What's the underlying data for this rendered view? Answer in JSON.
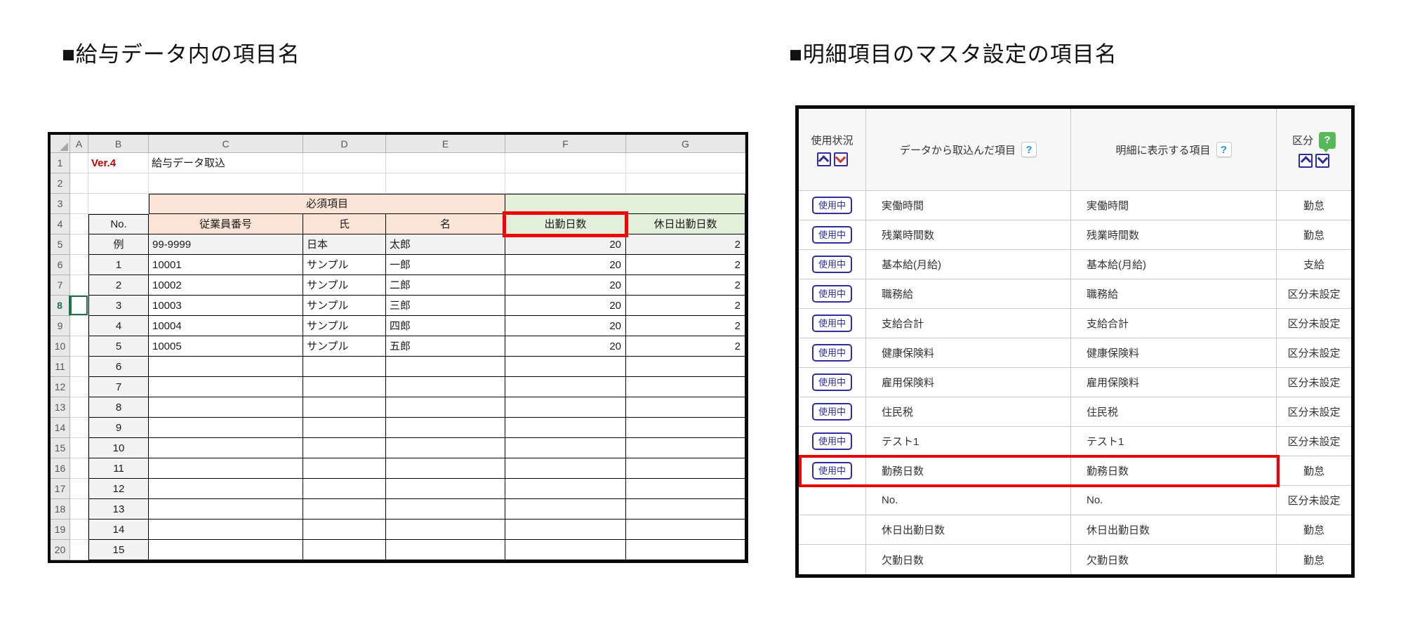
{
  "left_panel": {
    "title": "■給与データ内の項目名",
    "spreadsheet": {
      "column_headers": [
        "A",
        "B",
        "C",
        "D",
        "E",
        "F",
        "G"
      ],
      "rows_total": 20,
      "version_label": "Ver.4",
      "sheet_title": "給与データ取込",
      "required_banner": "必須項目",
      "table_headers": [
        "No.",
        "従業員番号",
        "氏",
        "名",
        "出勤日数",
        "休日出勤日数"
      ],
      "data_rows": [
        [
          "例",
          "99-9999",
          "日本",
          "太郎",
          "20",
          "2"
        ],
        [
          "1",
          "10001",
          "サンプル",
          "一郎",
          "20",
          "2"
        ],
        [
          "2",
          "10002",
          "サンプル",
          "二郎",
          "20",
          "2"
        ],
        [
          "3",
          "10003",
          "サンプル",
          "三郎",
          "20",
          "2"
        ],
        [
          "4",
          "10004",
          "サンプル",
          "四郎",
          "20",
          "2"
        ],
        [
          "5",
          "10005",
          "サンプル",
          "五郎",
          "20",
          "2"
        ],
        [
          "6",
          "",
          "",
          "",
          "",
          ""
        ],
        [
          "7",
          "",
          "",
          "",
          "",
          ""
        ],
        [
          "8",
          "",
          "",
          "",
          "",
          ""
        ],
        [
          "9",
          "",
          "",
          "",
          "",
          ""
        ],
        [
          "10",
          "",
          "",
          "",
          "",
          ""
        ],
        [
          "11",
          "",
          "",
          "",
          "",
          ""
        ],
        [
          "12",
          "",
          "",
          "",
          "",
          ""
        ],
        [
          "13",
          "",
          "",
          "",
          "",
          ""
        ],
        [
          "14",
          "",
          "",
          "",
          "",
          ""
        ],
        [
          "15",
          "",
          "",
          "",
          "",
          ""
        ]
      ],
      "active_row_header": 8,
      "highlighted_header": "出勤日数"
    }
  },
  "right_panel": {
    "title": "■明細項目のマスタ設定の項目名",
    "table": {
      "headers": {
        "usage": "使用状況",
        "imported": "データから取込んだ項目",
        "display": "明細に表示する項目",
        "kubun": "区分"
      },
      "help_label": "?",
      "in_use_label": "使用中",
      "rows": [
        {
          "in_use": true,
          "imported": "実働時間",
          "display": "実働時間",
          "kubun": "勤怠",
          "highlighted": false
        },
        {
          "in_use": true,
          "imported": "残業時間数",
          "display": "残業時間数",
          "kubun": "勤怠",
          "highlighted": false
        },
        {
          "in_use": true,
          "imported": "基本給(月給)",
          "display": "基本給(月給)",
          "kubun": "支給",
          "highlighted": false
        },
        {
          "in_use": true,
          "imported": "職務給",
          "display": "職務給",
          "kubun": "区分未設定",
          "highlighted": false
        },
        {
          "in_use": true,
          "imported": "支給合計",
          "display": "支給合計",
          "kubun": "区分未設定",
          "highlighted": false
        },
        {
          "in_use": true,
          "imported": "健康保険料",
          "display": "健康保険料",
          "kubun": "区分未設定",
          "highlighted": false
        },
        {
          "in_use": true,
          "imported": "雇用保険料",
          "display": "雇用保険料",
          "kubun": "区分未設定",
          "highlighted": false
        },
        {
          "in_use": true,
          "imported": "住民税",
          "display": "住民税",
          "kubun": "区分未設定",
          "highlighted": false
        },
        {
          "in_use": true,
          "imported": "テスト1",
          "display": "テスト1",
          "kubun": "区分未設定",
          "highlighted": false
        },
        {
          "in_use": true,
          "imported": "勤務日数",
          "display": "勤務日数",
          "kubun": "勤怠",
          "highlighted": true
        },
        {
          "in_use": false,
          "imported": "No.",
          "display": "No.",
          "kubun": "区分未設定",
          "highlighted": false
        },
        {
          "in_use": false,
          "imported": "休日出勤日数",
          "display": "休日出勤日数",
          "kubun": "勤怠",
          "highlighted": false
        },
        {
          "in_use": false,
          "imported": "欠勤日数",
          "display": "欠勤日数",
          "kubun": "勤怠",
          "highlighted": false
        }
      ]
    }
  },
  "colors": {
    "required_fill": "#fce4d6",
    "optional_fill": "#e2efda",
    "example_fill": "#f2f2f2",
    "version_text": "#c00000",
    "highlight_red": "#e60505",
    "button_navy": "#2e2e9e",
    "sort_down_red": "#d93030",
    "help_blue": "#2196f3",
    "kubun_badge_green": "#57b957",
    "active_cell_green": "#1e7145"
  }
}
